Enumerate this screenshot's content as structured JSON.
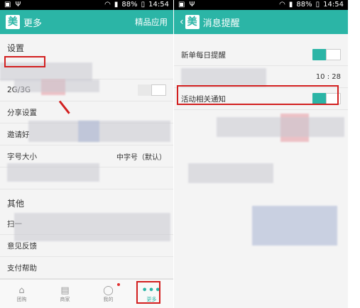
{
  "status": {
    "battery": "88%",
    "time": "14:54"
  },
  "left": {
    "app_title": "更多",
    "logo_char": "美",
    "header_action": "精品应用",
    "section_settings": "设置",
    "rows": {
      "row1": "",
      "row2": "2G/3G",
      "row3": "分享设置",
      "row4": "邀请好",
      "row5": "字号大小",
      "row5_value": "中字号（默认）"
    },
    "section_other": "其他",
    "rows2": {
      "scan": "扫一",
      "feedback": "意见反馈",
      "payhelp": "支付帮助"
    },
    "nav": [
      {
        "label": "团购",
        "icon": "groupbuy-icon"
      },
      {
        "label": "商家",
        "icon": "shop-icon"
      },
      {
        "label": "我的",
        "icon": "user-icon"
      },
      {
        "label": "更多",
        "icon": "more-icon"
      }
    ]
  },
  "right": {
    "app_title": "消息提醒",
    "logo_char": "美",
    "rows": {
      "daily": "新单每日提醒",
      "time": "10 : 28",
      "activity": "活动相关通知"
    }
  },
  "colors": {
    "brand": "#2bb5a6",
    "highlight": "#d21f1f"
  }
}
